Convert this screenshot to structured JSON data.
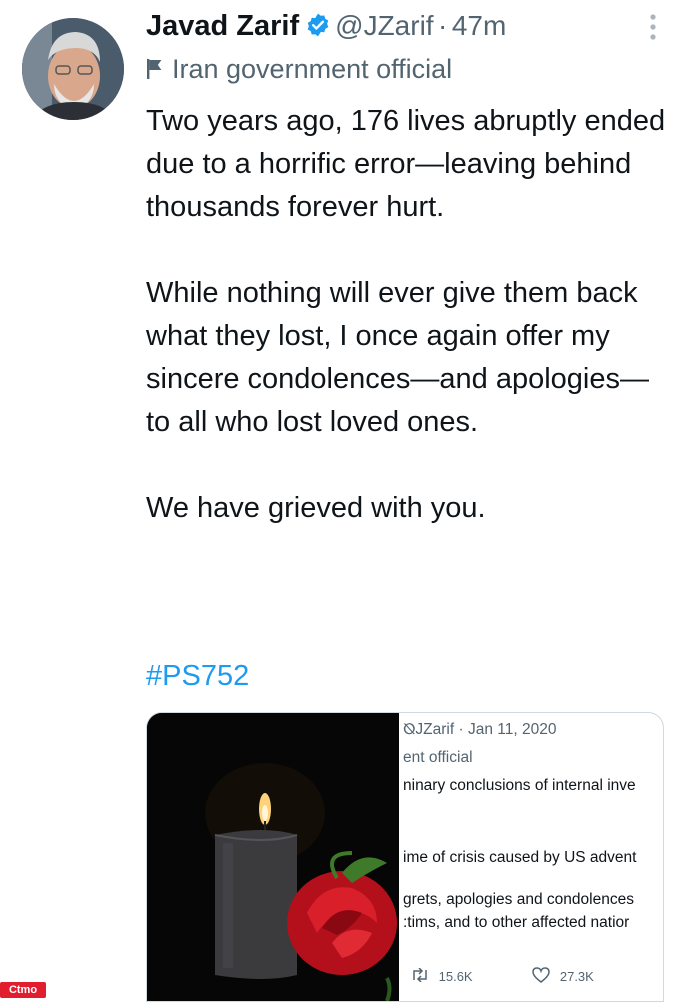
{
  "tweet": {
    "author_name": "Javad Zarif",
    "handle": "@JZarif",
    "separator": "·",
    "time": "47m",
    "label": "Iran government official",
    "paragraphs": [
      "Two years ago, 176 lives abruptly ended due to a horrific error—leaving behind thousands forever hurt.",
      "While nothing will ever give them back what they lost, I once again offer my sincere condolences—and apologies—to all who lost loved ones.",
      "We have grieved with you."
    ],
    "hashtag": "#PS752"
  },
  "quoted": {
    "header": "⦰JZarif · Jan 11, 2020",
    "label": "ent official",
    "line1": "ninary conclusions of internal inve",
    "line2": "ime of crisis caused by US advent",
    "line3": "grets, apologies and condolences",
    "line4": ":tims, and to other affected natior",
    "retweets": "15.6K",
    "likes": "27.3K"
  },
  "watermark": "Ctmo",
  "colors": {
    "accent": "#1d9bf0",
    "muted": "#536471",
    "text": "#0f1419"
  }
}
